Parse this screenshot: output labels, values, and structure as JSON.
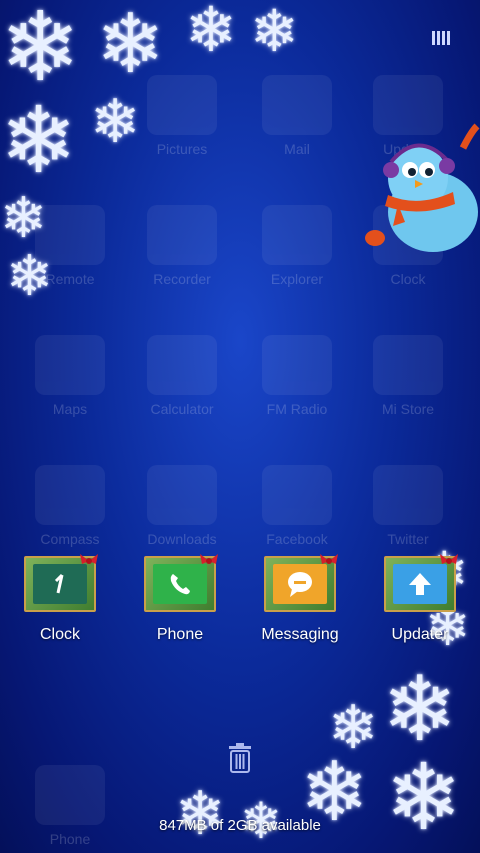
{
  "home": {
    "ghost_apps": [
      "Pictures",
      "Mail",
      "Updater",
      "Remote",
      "Recorder",
      "Explorer",
      "Clock",
      "Maps",
      "Calculator",
      "FM Radio",
      "Mi Store",
      "Compass",
      "Downloads",
      "Facebook",
      "Twitter",
      "Phone"
    ],
    "dock_apps": [
      {
        "label": "Clock",
        "icon": "clock-icon",
        "color": "#1f6b55"
      },
      {
        "label": "Phone",
        "icon": "phone-icon",
        "color": "#2fb24a"
      },
      {
        "label": "Messaging",
        "icon": "messaging-icon",
        "color": "#f0a52a"
      },
      {
        "label": "Updater",
        "icon": "updater-icon",
        "color": "#3aa0e6"
      }
    ]
  },
  "edit_mode": {
    "storage_text": "847MB of 2GB available",
    "trash_icon": "trash-icon"
  }
}
